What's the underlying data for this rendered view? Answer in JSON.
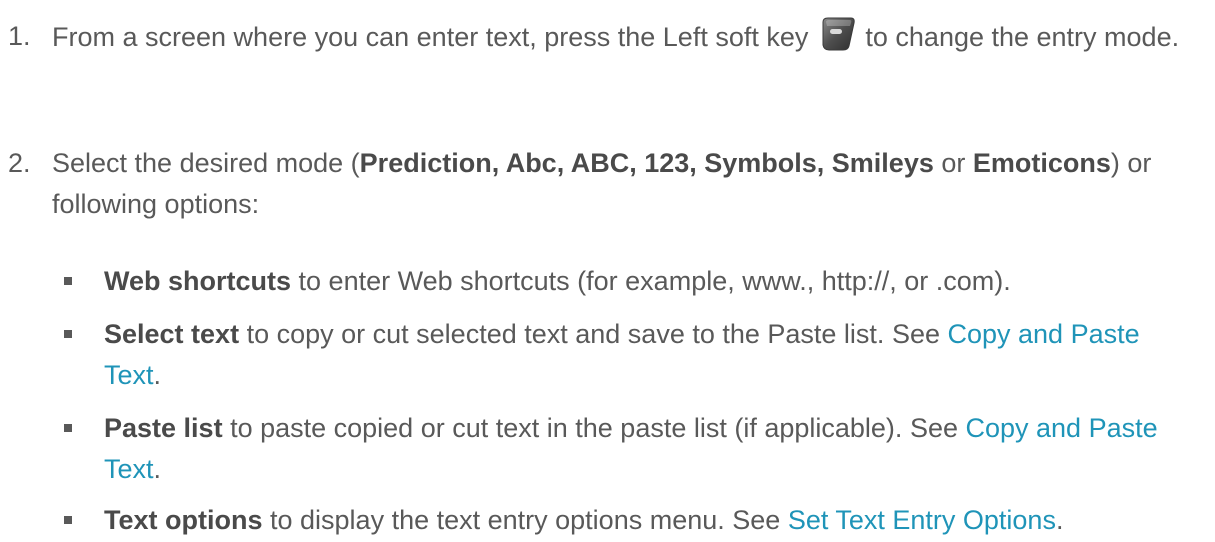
{
  "steps": [
    {
      "number": "1.",
      "text_a": "From a screen where you can enter text, press the Left soft key",
      "key_icon": "left-soft-key-icon",
      "text_b": "to change the entry mode."
    },
    {
      "number": "2.",
      "text_a": "Select the desired mode (",
      "bold_modes": "Prediction, Abc, ABC, 123, Symbols, Smileys",
      "text_or": " or ",
      "bold_last": "Emoticons",
      "text_b": ") or following options:"
    }
  ],
  "bullets": [
    {
      "term": "Web shortcuts",
      "text": " to enter Web shortcuts (for example, www., http://, or .com).",
      "see": "",
      "link": ""
    },
    {
      "term": "Select text",
      "text": " to copy or cut selected text and save to the Paste list. ",
      "see": "See ",
      "link": "Copy and Paste Text"
    },
    {
      "term": "Paste list",
      "text": " to paste copied or cut text in the paste list (if applicable). ",
      "see": "See ",
      "link": "Copy and Paste Text"
    },
    {
      "term": "Text options",
      "text": " to display the text entry options menu. ",
      "see": "See ",
      "link": "Set Text Entry Options"
    }
  ],
  "colors": {
    "text": "#595959",
    "link": "#1f94b8",
    "key_body": "#4d4d4d",
    "key_highlight": "#d9d9d9"
  }
}
